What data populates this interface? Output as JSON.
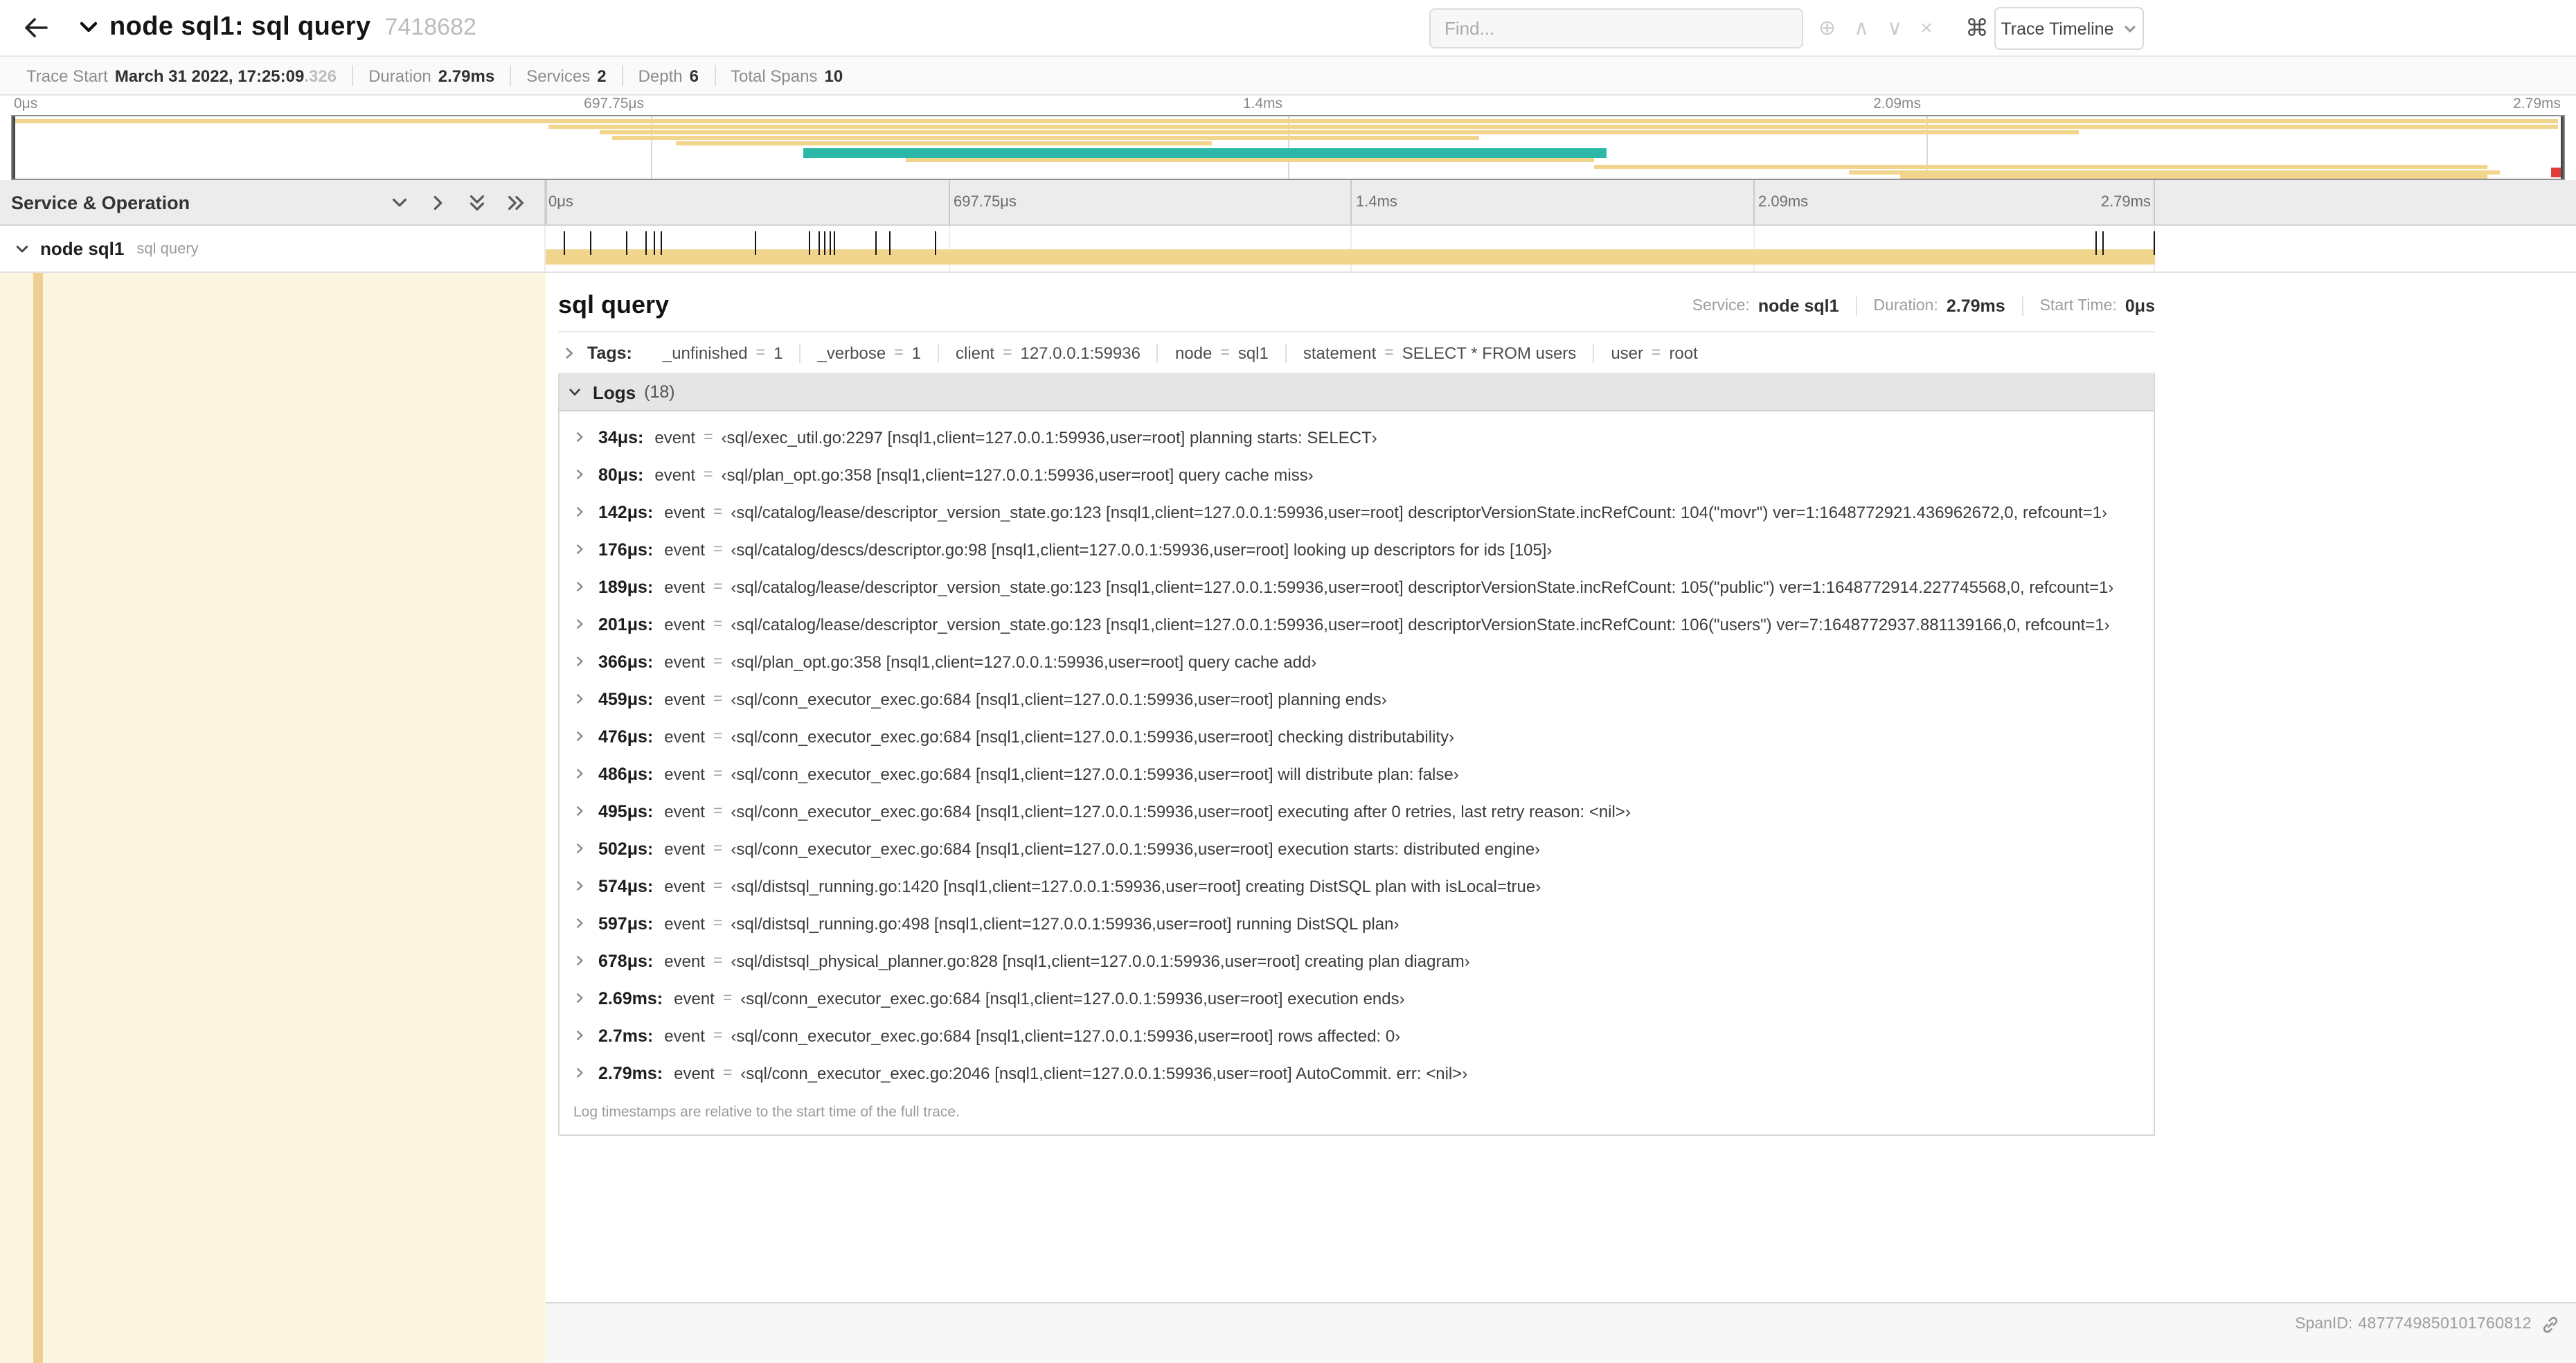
{
  "theme": {
    "span_tan": "#f2d58d",
    "span_teal": "#2cb8a8",
    "selected_bg": "#fcf5df",
    "accent_strip": "#efd092",
    "marker_red": "#e23b3b"
  },
  "icons": {
    "focus_matches": "⊕",
    "prev_match": "∧",
    "next_match": "∨",
    "clear_search": "×",
    "keyboard_shortcuts": "⌘"
  },
  "header": {
    "title": "node sql1: sql query",
    "trace_id": "7418682",
    "find_placeholder": "Find...",
    "view_button": "Trace Timeline"
  },
  "summary": {
    "items": [
      {
        "label": "Trace Start",
        "value": "March 31 2022, 17:25:09",
        "suffix": ".326"
      },
      {
        "label": "Duration",
        "value": "2.79ms"
      },
      {
        "label": "Services",
        "value": "2"
      },
      {
        "label": "Depth",
        "value": "6"
      },
      {
        "label": "Total Spans",
        "value": "10"
      }
    ]
  },
  "timeline": {
    "header_title": "Service & Operation",
    "ticks": [
      "0μs",
      "697.75μs",
      "1.4ms",
      "2.09ms",
      "2.79ms"
    ]
  },
  "trace": {
    "duration_us": 2790
  },
  "minimap": {
    "spans": [
      {
        "row": 0,
        "l": 0,
        "w": 99.8,
        "c": "span_tan"
      },
      {
        "row": 1,
        "l": 21,
        "w": 78.8,
        "c": "span_tan"
      },
      {
        "row": 2,
        "l": 23,
        "w": 58,
        "c": "span_tan"
      },
      {
        "row": 3,
        "l": 23.5,
        "w": 34,
        "c": "span_tan"
      },
      {
        "row": 4,
        "l": 26,
        "w": 21,
        "c": "span_tan"
      },
      {
        "row": 5,
        "l": 31,
        "w": 31.5,
        "c": "span_teal",
        "tall": true
      },
      {
        "row": 6.9,
        "l": 35,
        "w": 27,
        "c": "span_tan"
      },
      {
        "row": 7.9,
        "l": 62,
        "w": 35,
        "c": "span_tan"
      },
      {
        "row": 8.9,
        "l": 72,
        "w": 25.5,
        "c": "span_tan"
      },
      {
        "row": 9.7,
        "l": 74,
        "w": 23,
        "c": "span_tan"
      },
      {
        "row": 8.4,
        "l": 99.5,
        "w": 0.5,
        "c": "marker_red",
        "tall": true
      }
    ]
  },
  "span_row": {
    "service": "node sql1",
    "operation": "sql query",
    "log_times_us": [
      34,
      80,
      142,
      176,
      189,
      201,
      366,
      459,
      476,
      486,
      495,
      502,
      574,
      597,
      678,
      2690,
      2700,
      2790
    ]
  },
  "detail": {
    "title": "sql query",
    "stats": [
      {
        "label": "Service:",
        "value": "node sql1"
      },
      {
        "label": "Duration:",
        "value": "2.79ms"
      },
      {
        "label": "Start Time:",
        "value": "0μs"
      }
    ],
    "tags_label": "Tags:",
    "tags": [
      {
        "key": "_unfinished",
        "value": "1"
      },
      {
        "key": "_verbose",
        "value": "1"
      },
      {
        "key": "client",
        "value": "127.0.0.1:59936"
      },
      {
        "key": "node",
        "value": "sql1"
      },
      {
        "key": "statement",
        "value": "SELECT * FROM users"
      },
      {
        "key": "user",
        "value": "root"
      }
    ],
    "logs_label": "Logs",
    "logs_count": "(18)",
    "logs": [
      {
        "time": "34μs:",
        "key": "event",
        "value": "‹sql/exec_util.go:2297 [nsql1,client=127.0.0.1:59936,user=root] planning starts: SELECT›"
      },
      {
        "time": "80μs:",
        "key": "event",
        "value": "‹sql/plan_opt.go:358 [nsql1,client=127.0.0.1:59936,user=root] query cache miss›"
      },
      {
        "time": "142μs:",
        "key": "event",
        "value": "‹sql/catalog/lease/descriptor_version_state.go:123 [nsql1,client=127.0.0.1:59936,user=root] descriptorVersionState.incRefCount: 104(\"movr\") ver=1:1648772921.436962672,0, refcount=1›"
      },
      {
        "time": "176μs:",
        "key": "event",
        "value": "‹sql/catalog/descs/descriptor.go:98 [nsql1,client=127.0.0.1:59936,user=root] looking up descriptors for ids [105]›"
      },
      {
        "time": "189μs:",
        "key": "event",
        "value": "‹sql/catalog/lease/descriptor_version_state.go:123 [nsql1,client=127.0.0.1:59936,user=root] descriptorVersionState.incRefCount: 105(\"public\") ver=1:1648772914.227745568,0, refcount=1›"
      },
      {
        "time": "201μs:",
        "key": "event",
        "value": "‹sql/catalog/lease/descriptor_version_state.go:123 [nsql1,client=127.0.0.1:59936,user=root] descriptorVersionState.incRefCount: 106(\"users\") ver=7:1648772937.881139166,0, refcount=1›"
      },
      {
        "time": "366μs:",
        "key": "event",
        "value": "‹sql/plan_opt.go:358 [nsql1,client=127.0.0.1:59936,user=root] query cache add›"
      },
      {
        "time": "459μs:",
        "key": "event",
        "value": "‹sql/conn_executor_exec.go:684 [nsql1,client=127.0.0.1:59936,user=root] planning ends›"
      },
      {
        "time": "476μs:",
        "key": "event",
        "value": "‹sql/conn_executor_exec.go:684 [nsql1,client=127.0.0.1:59936,user=root] checking distributability›"
      },
      {
        "time": "486μs:",
        "key": "event",
        "value": "‹sql/conn_executor_exec.go:684 [nsql1,client=127.0.0.1:59936,user=root] will distribute plan: false›"
      },
      {
        "time": "495μs:",
        "key": "event",
        "value": "‹sql/conn_executor_exec.go:684 [nsql1,client=127.0.0.1:59936,user=root] executing after 0 retries, last retry reason: <nil>›"
      },
      {
        "time": "502μs:",
        "key": "event",
        "value": "‹sql/conn_executor_exec.go:684 [nsql1,client=127.0.0.1:59936,user=root] execution starts: distributed engine›"
      },
      {
        "time": "574μs:",
        "key": "event",
        "value": "‹sql/distsql_running.go:1420 [nsql1,client=127.0.0.1:59936,user=root] creating DistSQL plan with isLocal=true›"
      },
      {
        "time": "597μs:",
        "key": "event",
        "value": "‹sql/distsql_running.go:498 [nsql1,client=127.0.0.1:59936,user=root] running DistSQL plan›"
      },
      {
        "time": "678μs:",
        "key": "event",
        "value": "‹sql/distsql_physical_planner.go:828 [nsql1,client=127.0.0.1:59936,user=root] creating plan diagram›"
      },
      {
        "time": "2.69ms:",
        "key": "event",
        "value": "‹sql/conn_executor_exec.go:684 [nsql1,client=127.0.0.1:59936,user=root] execution ends›"
      },
      {
        "time": "2.7ms:",
        "key": "event",
        "value": "‹sql/conn_executor_exec.go:684 [nsql1,client=127.0.0.1:59936,user=root] rows affected: 0›"
      },
      {
        "time": "2.79ms:",
        "key": "event",
        "value": "‹sql/conn_executor_exec.go:2046 [nsql1,client=127.0.0.1:59936,user=root] AutoCommit. err: <nil>›"
      }
    ],
    "logs_footnote": "Log timestamps are relative to the start time of the full trace.",
    "span_id_label": "SpanID:",
    "span_id": "4877749850101760812"
  }
}
